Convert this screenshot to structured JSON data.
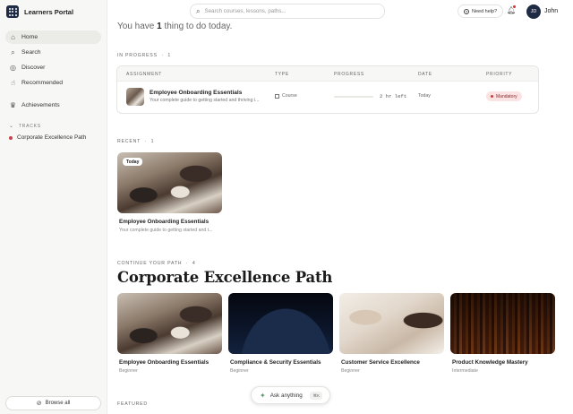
{
  "brand": {
    "name": "Learners Portal"
  },
  "sidebar": {
    "items": [
      {
        "label": "Home",
        "icon": "home-icon"
      },
      {
        "label": "Search",
        "icon": "search-icon"
      },
      {
        "label": "Discover",
        "icon": "compass-icon"
      },
      {
        "label": "Recommended",
        "icon": "thumbs-up-icon"
      },
      {
        "label": "Achievements",
        "icon": "trophy-icon"
      }
    ],
    "tracks_heading": "TRACKS",
    "tracks": [
      {
        "label": "Corporate Excellence Path",
        "color": "#c8414a"
      }
    ],
    "browse_all": "Browse all"
  },
  "header": {
    "search_placeholder": "Search courses, lessons, paths...",
    "help_label": "Need help?",
    "user_initials": "JD",
    "user_name": "John"
  },
  "greeting": {
    "prefix": "You have ",
    "count": "1",
    "suffix": " thing to do today."
  },
  "in_progress": {
    "label": "IN PROGRESS",
    "count": "1",
    "columns": [
      "ASSIGNMENT",
      "TYPE",
      "PROGRESS",
      "DATE",
      "PRIORITY"
    ],
    "rows": [
      {
        "title": "Employee Onboarding Essentials",
        "subtitle": "Your complete guide to getting started and thriving i...",
        "type": "Course",
        "progress_fraction": 0.0,
        "time_left": "2 hr left",
        "date": "Today",
        "priority": "Mandatory"
      }
    ]
  },
  "recent": {
    "label": "RECENT",
    "count": "1",
    "items": [
      {
        "chip": "Today",
        "title": "Employee Onboarding Essentials",
        "subtitle": "Your complete guide to getting started and t..."
      }
    ]
  },
  "continue_path": {
    "label": "CONTINUE YOUR PATH",
    "count": "4",
    "title": "Corporate Excellence Path",
    "courses": [
      {
        "title": "Employee Onboarding Essentials",
        "level": "Beginner"
      },
      {
        "title": "Compliance & Security Essentials",
        "level": "Beginner"
      },
      {
        "title": "Customer Service Excellence",
        "level": "Beginner"
      },
      {
        "title": "Product Knowledge Mastery",
        "level": "Intermediate"
      }
    ]
  },
  "featured": {
    "label": "FEATURED"
  },
  "ask": {
    "label": "Ask anything",
    "shortcut": "⌘K"
  },
  "colors": {
    "brand": "#1f2a44",
    "mandatory_bg": "#fbe3e3",
    "mandatory_dot": "#c24040"
  }
}
